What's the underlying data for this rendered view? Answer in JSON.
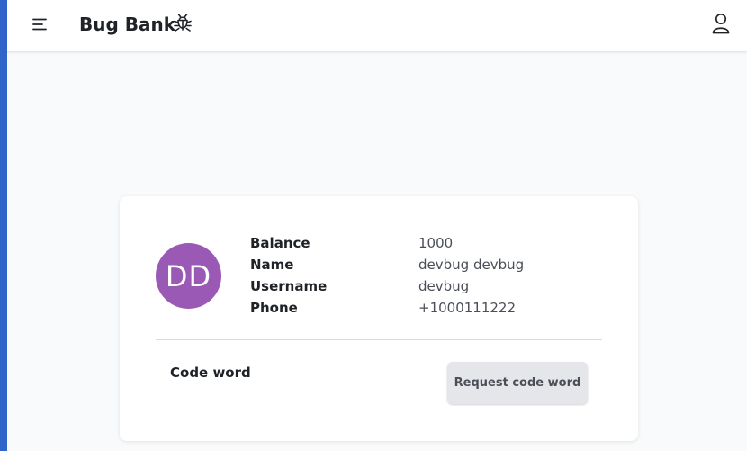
{
  "header": {
    "title": "Bug Bank",
    "menu_icon": "menu-icon",
    "logo_icon": "bug-icon",
    "account_icon": "user-icon"
  },
  "account": {
    "avatar_initials": "DD",
    "avatar_color": "#9b59b6",
    "fields": [
      {
        "label": "Balance",
        "value": "1000"
      },
      {
        "label": "Name",
        "value": "devbug devbug"
      },
      {
        "label": "Username",
        "value": "devbug"
      },
      {
        "label": "Phone",
        "value": "+1000111222"
      }
    ]
  },
  "code_word": {
    "label": "Code word",
    "button_label": "Request code word"
  },
  "colors": {
    "accent_edge": "#2f64c9",
    "background": "#f9fafb"
  }
}
